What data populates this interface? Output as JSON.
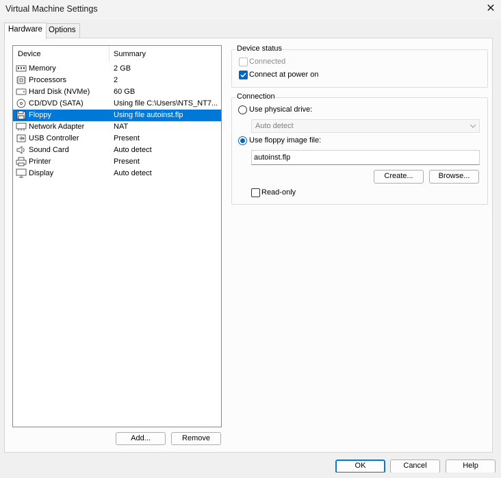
{
  "window": {
    "title": "Virtual Machine Settings",
    "close_glyph": "✕"
  },
  "tabs": [
    {
      "label": "Hardware",
      "active": true
    },
    {
      "label": "Options",
      "active": false
    }
  ],
  "device_list": {
    "columns": [
      "Device",
      "Summary"
    ],
    "rows": [
      {
        "icon": "memory-icon",
        "device": "Memory",
        "summary": "2 GB",
        "selected": false
      },
      {
        "icon": "processor-icon",
        "device": "Processors",
        "summary": "2",
        "selected": false
      },
      {
        "icon": "hard-disk-icon",
        "device": "Hard Disk (NVMe)",
        "summary": "60 GB",
        "selected": false
      },
      {
        "icon": "cd-dvd-icon",
        "device": "CD/DVD (SATA)",
        "summary": "Using file C:\\Users\\NTS_NT7...",
        "selected": false
      },
      {
        "icon": "floppy-icon",
        "device": "Floppy",
        "summary": "Using file autoinst.flp",
        "selected": true
      },
      {
        "icon": "network-adapter-icon",
        "device": "Network Adapter",
        "summary": "NAT",
        "selected": false
      },
      {
        "icon": "usb-icon",
        "device": "USB Controller",
        "summary": "Present",
        "selected": false
      },
      {
        "icon": "sound-card-icon",
        "device": "Sound Card",
        "summary": "Auto detect",
        "selected": false
      },
      {
        "icon": "printer-icon",
        "device": "Printer",
        "summary": "Present",
        "selected": false
      },
      {
        "icon": "display-icon",
        "device": "Display",
        "summary": "Auto detect",
        "selected": false
      }
    ],
    "add_label": "Add...",
    "remove_label": "Remove"
  },
  "device_status": {
    "title": "Device status",
    "connected_label": "Connected",
    "connected_checked": false,
    "connected_enabled": false,
    "connect_power_label": "Connect at power on",
    "connect_power_checked": true
  },
  "connection": {
    "title": "Connection",
    "physical_label": "Use physical drive:",
    "physical_selected": false,
    "physical_value": "Auto detect",
    "image_label": "Use floppy image file:",
    "image_selected": true,
    "image_value": "autoinst.flp",
    "create_label": "Create...",
    "browse_label": "Browse...",
    "readonly_label": "Read-only",
    "readonly_checked": false
  },
  "footer": {
    "ok": "OK",
    "cancel": "Cancel",
    "help": "Help"
  },
  "colors": {
    "selection": "#0078d7",
    "accent": "#0067c0"
  }
}
